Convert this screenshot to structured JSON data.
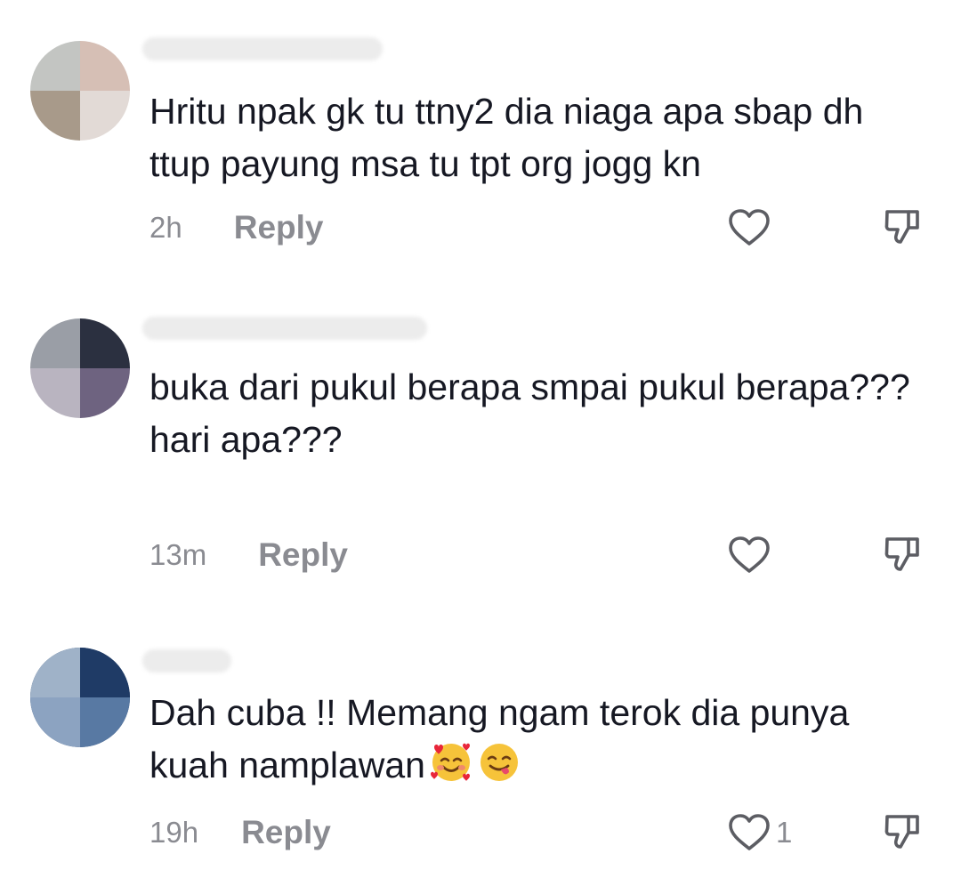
{
  "comments": [
    {
      "username": "",
      "avatar_colors": [
        "#c3c5c2",
        "#d6bfb5",
        "#a89a8a",
        "#e2dad6"
      ],
      "text": "Hritu npak gk tu ttny2 dia niaga apa sbap dh ttup payung msa tu tpt org jogg kn",
      "time": "2h",
      "reply_label": "Reply",
      "like_count": ""
    },
    {
      "username": "",
      "avatar_colors": [
        "#9a9ea6",
        "#2b3040",
        "#b9b4c0",
        "#6e6380"
      ],
      "text": "buka dari pukul berapa smpai pukul berapa???\nhari apa???",
      "time": "13m",
      "reply_label": "Reply",
      "like_count": ""
    },
    {
      "username": "",
      "avatar_colors": [
        "#9fb2c8",
        "#1f3b66",
        "#8ca3c1",
        "#5879a3"
      ],
      "text": "Dah cuba !! Memang ngam terok dia punya kuah namplawan",
      "time": "19h",
      "reply_label": "Reply",
      "like_count": "1",
      "emojis": [
        "smiling-face-with-hearts",
        "face-savoring-food"
      ]
    }
  ],
  "colors": {
    "text": "#161823",
    "meta": "#8a8b91",
    "icon": "#5c5d63"
  }
}
